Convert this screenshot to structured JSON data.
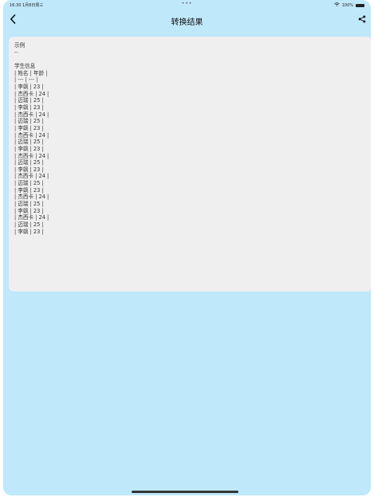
{
  "status_bar": {
    "time_date": "16:30  1月8日周三",
    "center_dots": "•••",
    "battery": "100%"
  },
  "nav": {
    "title": "转换结果",
    "back_icon": "chevron-left-icon",
    "share_icon": "share-icon"
  },
  "result": {
    "text": "示例\n--\n\n学生信息\n| 姓名 | 年龄 |\n| --- | --- |\n| 李飒 | 23 |\n| 杰西卡 | 24 |\n| 迈瑞 | 25 |\n| 李飒 | 23 |\n| 杰西卡 | 24 |\n| 迈瑞 | 25 |\n| 李飒 | 23 |\n| 杰西卡 | 24 |\n| 迈瑞 | 25 |\n| 李飒 | 23 |\n| 杰西卡 | 24 |\n| 迈瑞 | 25 |\n| 李飒 | 23 |\n| 杰西卡 | 24 |\n| 迈瑞 | 25 |\n| 李飒 | 23 |\n| 杰西卡 | 24 |\n| 迈瑞 | 25 |\n| 李飒 | 23 |\n| 杰西卡 | 24 |\n| 迈瑞 | 25 |\n| 李飒 | 23 |"
  },
  "colors": {
    "background": "#bfe8fb",
    "card": "#efefef",
    "text": "#333333"
  }
}
